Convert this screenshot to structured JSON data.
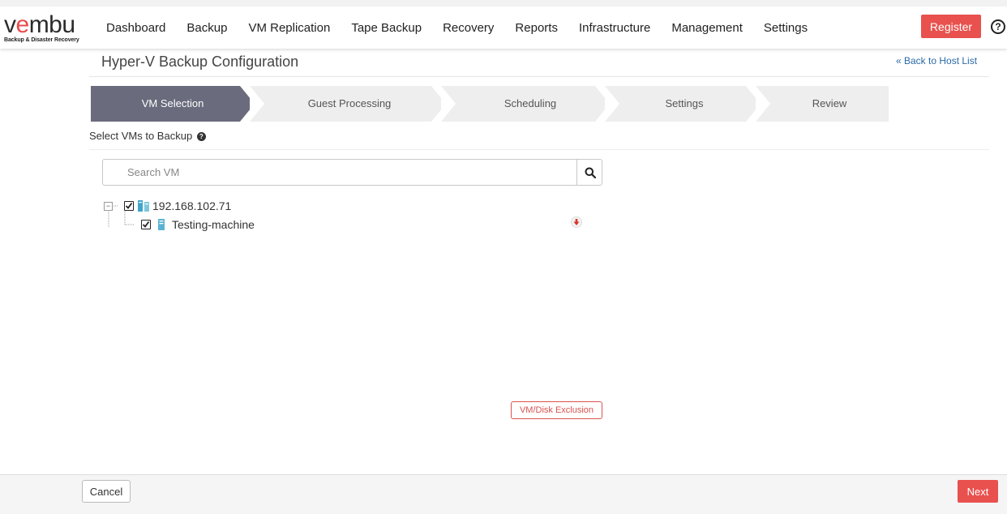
{
  "brand": {
    "logo_text": "vembu",
    "tagline": "Backup & Disaster Recovery",
    "accent_color": "#e8514e"
  },
  "nav": {
    "items": [
      {
        "label": "Dashboard"
      },
      {
        "label": "Backup"
      },
      {
        "label": "VM Replication"
      },
      {
        "label": "Tape Backup"
      },
      {
        "label": "Recovery"
      },
      {
        "label": "Reports"
      },
      {
        "label": "Infrastructure"
      },
      {
        "label": "Management"
      },
      {
        "label": "Settings"
      }
    ],
    "register_label": "Register",
    "help_icon": "question-circle-icon"
  },
  "page": {
    "title": "Hyper-V Backup Configuration",
    "back_link": "« Back to Host List"
  },
  "wizard": {
    "steps": [
      {
        "label": "VM Selection",
        "active": true
      },
      {
        "label": "Guest Processing",
        "active": false
      },
      {
        "label": "Scheduling",
        "active": false
      },
      {
        "label": "Settings",
        "active": false
      },
      {
        "label": "Review",
        "active": false
      }
    ],
    "active_color": "#6a6b7d",
    "inactive_color": "#eeeeee"
  },
  "selection": {
    "subtitle": "Select VMs to Backup",
    "search_placeholder": "Search VM",
    "tree": {
      "host": {
        "label": "192.168.102.71",
        "checked": true,
        "expanded": true
      },
      "vms": [
        {
          "label": "Testing-machine",
          "checked": true
        }
      ]
    },
    "exclusion_button": "VM/Disk Exclusion"
  },
  "footer": {
    "cancel_label": "Cancel",
    "next_label": "Next"
  }
}
